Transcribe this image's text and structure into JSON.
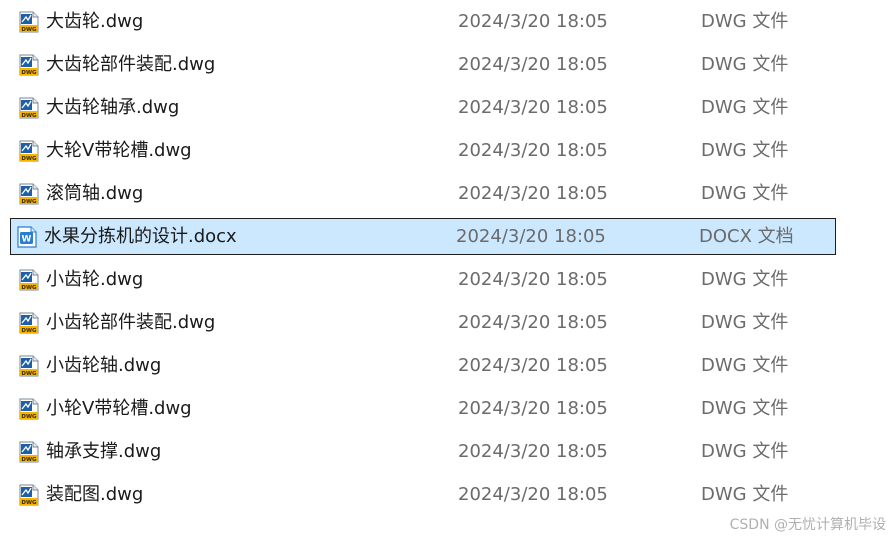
{
  "files": [
    {
      "name": "大齿轮.dwg",
      "modified": "2024/3/20 18:05",
      "type": "DWG 文件",
      "icon": "dwg-file-icon",
      "selected": false
    },
    {
      "name": "大齿轮部件装配.dwg",
      "modified": "2024/3/20 18:05",
      "type": "DWG 文件",
      "icon": "dwg-file-icon",
      "selected": false
    },
    {
      "name": "大齿轮轴承.dwg",
      "modified": "2024/3/20 18:05",
      "type": "DWG 文件",
      "icon": "dwg-file-icon",
      "selected": false
    },
    {
      "name": "大轮V带轮槽.dwg",
      "modified": "2024/3/20 18:05",
      "type": "DWG 文件",
      "icon": "dwg-file-icon",
      "selected": false
    },
    {
      "name": "滚筒轴.dwg",
      "modified": "2024/3/20 18:05",
      "type": "DWG 文件",
      "icon": "dwg-file-icon",
      "selected": false
    },
    {
      "name": "水果分拣机的设计.docx",
      "modified": "2024/3/20 18:05",
      "type": "DOCX 文档",
      "icon": "word-document-icon",
      "selected": true
    },
    {
      "name": "小齿轮.dwg",
      "modified": "2024/3/20 18:05",
      "type": "DWG 文件",
      "icon": "dwg-file-icon",
      "selected": false
    },
    {
      "name": "小齿轮部件装配.dwg",
      "modified": "2024/3/20 18:05",
      "type": "DWG 文件",
      "icon": "dwg-file-icon",
      "selected": false
    },
    {
      "name": "小齿轮轴.dwg",
      "modified": "2024/3/20 18:05",
      "type": "DWG 文件",
      "icon": "dwg-file-icon",
      "selected": false
    },
    {
      "name": "小轮V带轮槽.dwg",
      "modified": "2024/3/20 18:05",
      "type": "DWG 文件",
      "icon": "dwg-file-icon",
      "selected": false
    },
    {
      "name": "轴承支撑.dwg",
      "modified": "2024/3/20 18:05",
      "type": "DWG 文件",
      "icon": "dwg-file-icon",
      "selected": false
    },
    {
      "name": "装配图.dwg",
      "modified": "2024/3/20 18:05",
      "type": "DWG 文件",
      "icon": "dwg-file-icon",
      "selected": false
    }
  ],
  "icon_labels": {
    "dwg": "DWG",
    "word": "W"
  },
  "colors": {
    "selection_background": "#cce8ff",
    "selection_border": "#1f1f1f",
    "dwg_icon_blue": "#1e5fa8",
    "dwg_icon_yellow": "#f4b400",
    "word_icon_blue": "#2b7cd3",
    "secondary_text": "#6b6b6b"
  },
  "watermark": "CSDN @无忧计算机毕设"
}
